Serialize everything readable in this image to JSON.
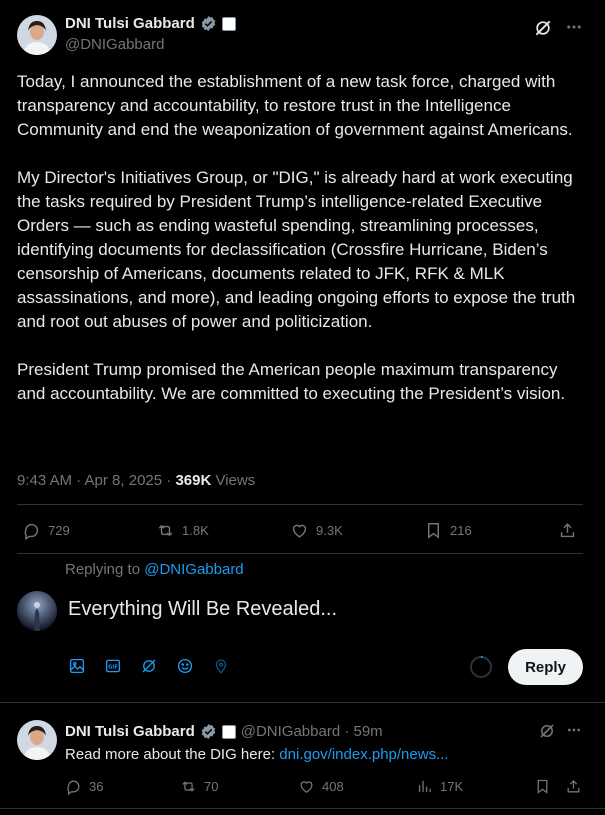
{
  "author": {
    "name": "DNI Tulsi Gabbard",
    "handle": "@DNIGabbard"
  },
  "post": {
    "paragraphs": [
      "Today, I announced the establishment of a new task force, charged with transparency and accountability, to restore trust in the Intelligence Community and end the weaponization of government against Americans.",
      "My Director's Initiatives Group, or \"DIG,\" is already hard at work executing the tasks required by President Trump’s intelligence-related Executive Orders — such as ending wasteful spending, streamlining processes, identifying documents for declassification (Crossfire Hurricane, Biden’s censorship of Americans, documents related to JFK, RFK & MLK assassinations, and more), and leading ongoing efforts to expose the truth and root out abuses of power and politicization.",
      "President Trump promised the American people maximum transparency and accountability. We are committed to executing the President’s vision."
    ],
    "timestamp": "9:43 AM · Apr 8, 2025 · ",
    "views_count": "369K",
    "views_label": "Views",
    "replies": "729",
    "reposts": "1.8K",
    "likes": "9.3K",
    "bookmarks": "216"
  },
  "composer": {
    "replying_to_label": "Replying to",
    "replying_to_handle": "@DNIGabbard",
    "draft_text": "Everything Will Be Revealed...",
    "reply_button": "Reply"
  },
  "reply": {
    "name": "DNI Tulsi Gabbard",
    "handle_time": "@DNIGabbard · 59m",
    "text_prefix": "Read more about the DIG here: ",
    "link": "dni.gov/index.php/news...",
    "replies": "36",
    "reposts": "70",
    "likes": "408",
    "views": "17K"
  },
  "colors": {
    "accent": "#1d9bf0",
    "background": "#000000",
    "muted": "#71767b"
  }
}
